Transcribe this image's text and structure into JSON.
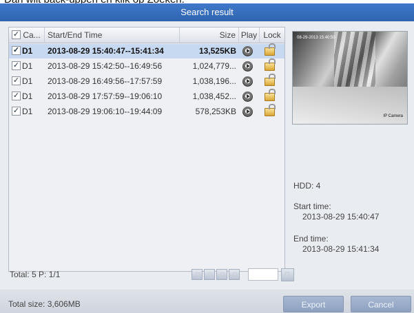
{
  "caption": "Dan wilt back-uppen en klik op Zoeken.",
  "dialog": {
    "title": "Search result"
  },
  "list": {
    "headers": {
      "camera": "Ca...",
      "time": "Start/End Time",
      "size": "Size",
      "play": "Play",
      "lock": "Lock"
    },
    "rows": [
      {
        "camera": "D1",
        "time": "2013-08-29 15:40:47--15:41:34",
        "size": "13,525KB"
      },
      {
        "camera": "D1",
        "time": "2013-08-29 15:42:50--16:49:56",
        "size": "1,024,779..."
      },
      {
        "camera": "D1",
        "time": "2013-08-29 16:49:56--17:57:59",
        "size": "1,038,196..."
      },
      {
        "camera": "D1",
        "time": "2013-08-29 17:57:59--19:06:10",
        "size": "1,038,452..."
      },
      {
        "camera": "D1",
        "time": "2013-08-29 19:06:10--19:44:09",
        "size": "578,253KB"
      }
    ],
    "total": "Total: 5  P: 1/1"
  },
  "preview": {
    "osd_time": "08-29-2013  15:40:50",
    "osd_camera": "IP Camera"
  },
  "details": {
    "hdd": "HDD: 4",
    "start_label": "Start time:",
    "start_value": "2013-08-29 15:40:47",
    "end_label": "End time:",
    "end_value": "2013-08-29 15:41:34"
  },
  "footer": {
    "total_size": "Total size: 3,606MB",
    "export_label": "Export",
    "cancel_label": "Cancel"
  },
  "colors": {
    "title_bar": "#3670bf",
    "selected_row": "#c7d9f0",
    "button": "#9aabc8"
  }
}
